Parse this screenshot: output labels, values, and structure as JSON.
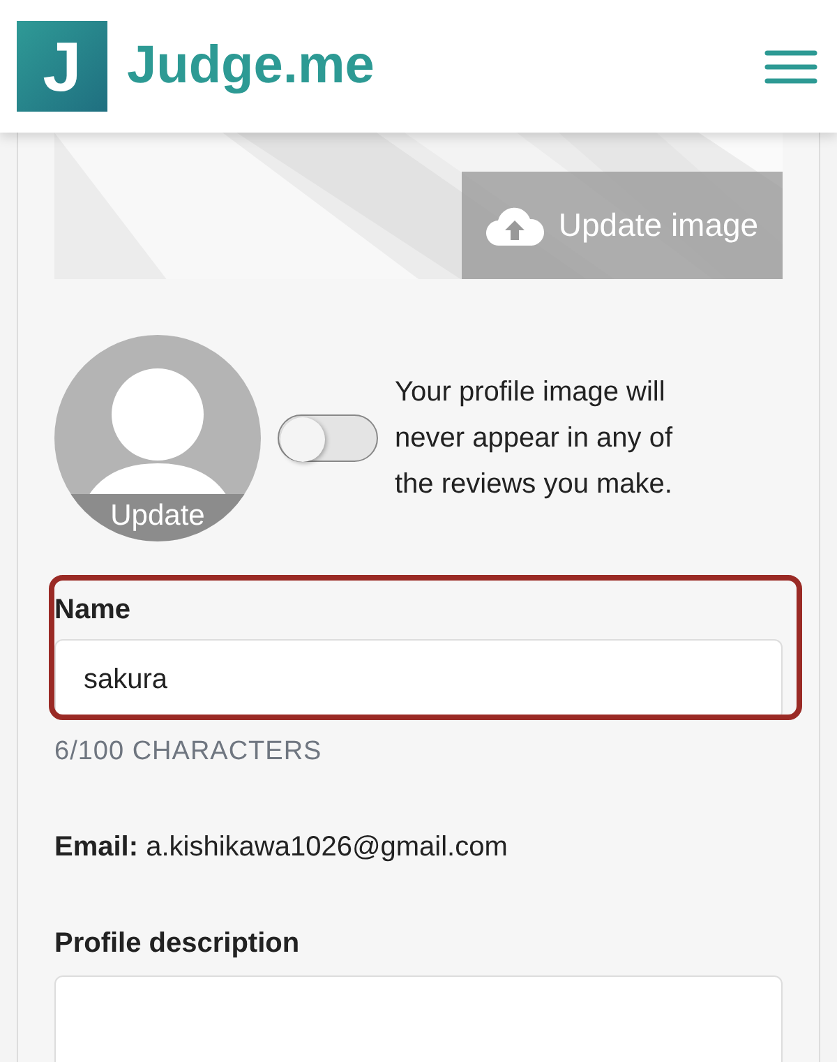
{
  "header": {
    "logo_letter": "J",
    "brand": "Judge.me"
  },
  "cover": {
    "kind": "picture",
    "update_button": "Update image"
  },
  "avatar": {
    "update_label": "Update"
  },
  "privacy": {
    "on": false,
    "text": "Your profile image will never appear in any of the reviews you make."
  },
  "name_field": {
    "label": "Name",
    "value": "sakura",
    "counter": "6/100 CHARACTERS",
    "highlighted": true
  },
  "email": {
    "label": "Email:",
    "value": "a.kishikawa1026@gmail.com"
  },
  "description_field": {
    "label": "Profile description"
  }
}
